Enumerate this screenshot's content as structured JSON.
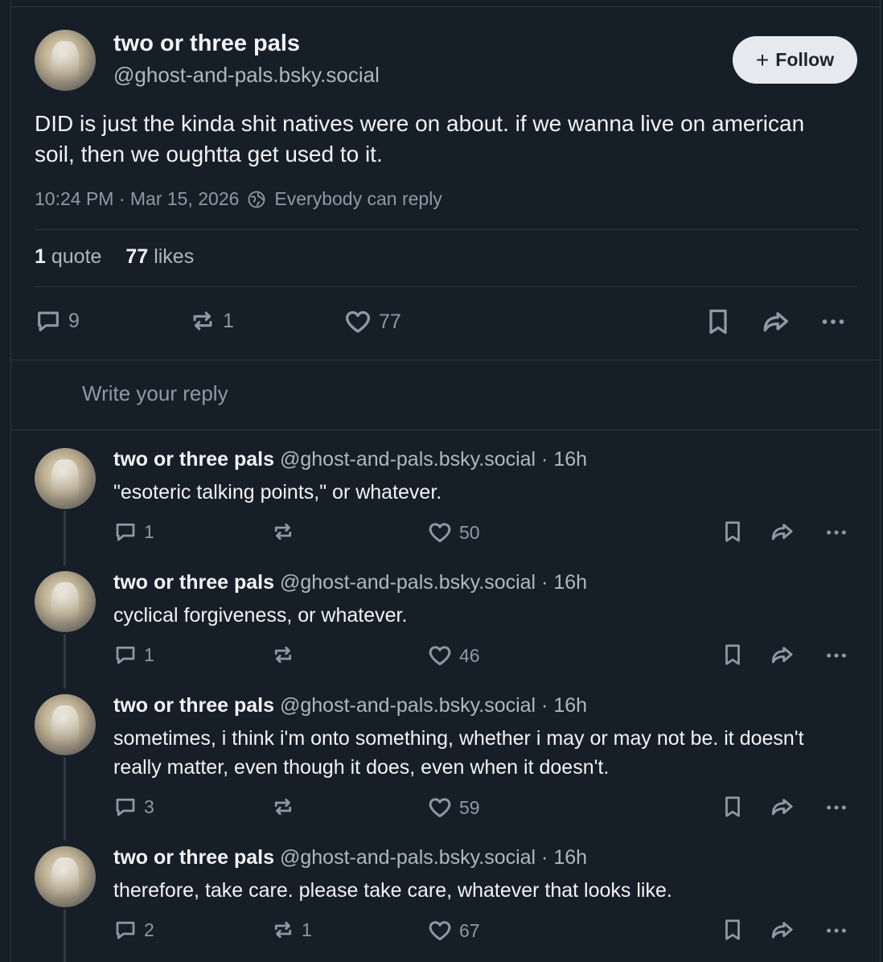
{
  "post": {
    "display_name": "two or three pals",
    "handle": "@ghost-and-pals.bsky.social",
    "follow_label": "Follow",
    "text": "DID is just the kinda shit natives were on about. if we wanna live on american soil, then we oughtta get used to it.",
    "timestamp": "10:24 PM · Mar 15, 2026",
    "reply_setting": "Everybody can reply",
    "quotes_count": "1",
    "quotes_label": "quote",
    "likes_count": "77",
    "likes_label": "likes",
    "reply_count": "9",
    "repost_count": "1",
    "like_count": "77"
  },
  "reply_placeholder": "Write your reply",
  "thread": [
    {
      "name": "two or three pals",
      "handle_time": "@ghost-and-pals.bsky.social · 16h",
      "text": "\"esoteric talking points,\" or whatever.",
      "replies": "1",
      "reposts": "",
      "likes": "50"
    },
    {
      "name": "two or three pals",
      "handle_time": "@ghost-and-pals.bsky.social · 16h",
      "text": "cyclical forgiveness, or whatever.",
      "replies": "1",
      "reposts": "",
      "likes": "46"
    },
    {
      "name": "two or three pals",
      "handle_time": "@ghost-and-pals.bsky.social · 16h",
      "text": "sometimes, i think i'm onto something, whether i may or may not be. it doesn't really matter, even though it does, even when it doesn't.",
      "replies": "3",
      "reposts": "",
      "likes": "59"
    },
    {
      "name": "two or three pals",
      "handle_time": "@ghost-and-pals.bsky.social · 16h",
      "text": "therefore, take care. please take care, whatever that looks like.",
      "replies": "2",
      "reposts": "1",
      "likes": "67"
    }
  ],
  "icons": {
    "reply": "reply-bubble-icon",
    "repost": "repost-icon",
    "like": "heart-icon",
    "bookmark": "bookmark-icon",
    "share": "share-icon",
    "more": "more-icon",
    "globe": "globe-icon"
  },
  "colors": {
    "background": "#161e27",
    "text": "#f1f3f5",
    "muted": "#8f99a6",
    "border": "#2e3847",
    "follow_bg": "#e6e9ee"
  }
}
